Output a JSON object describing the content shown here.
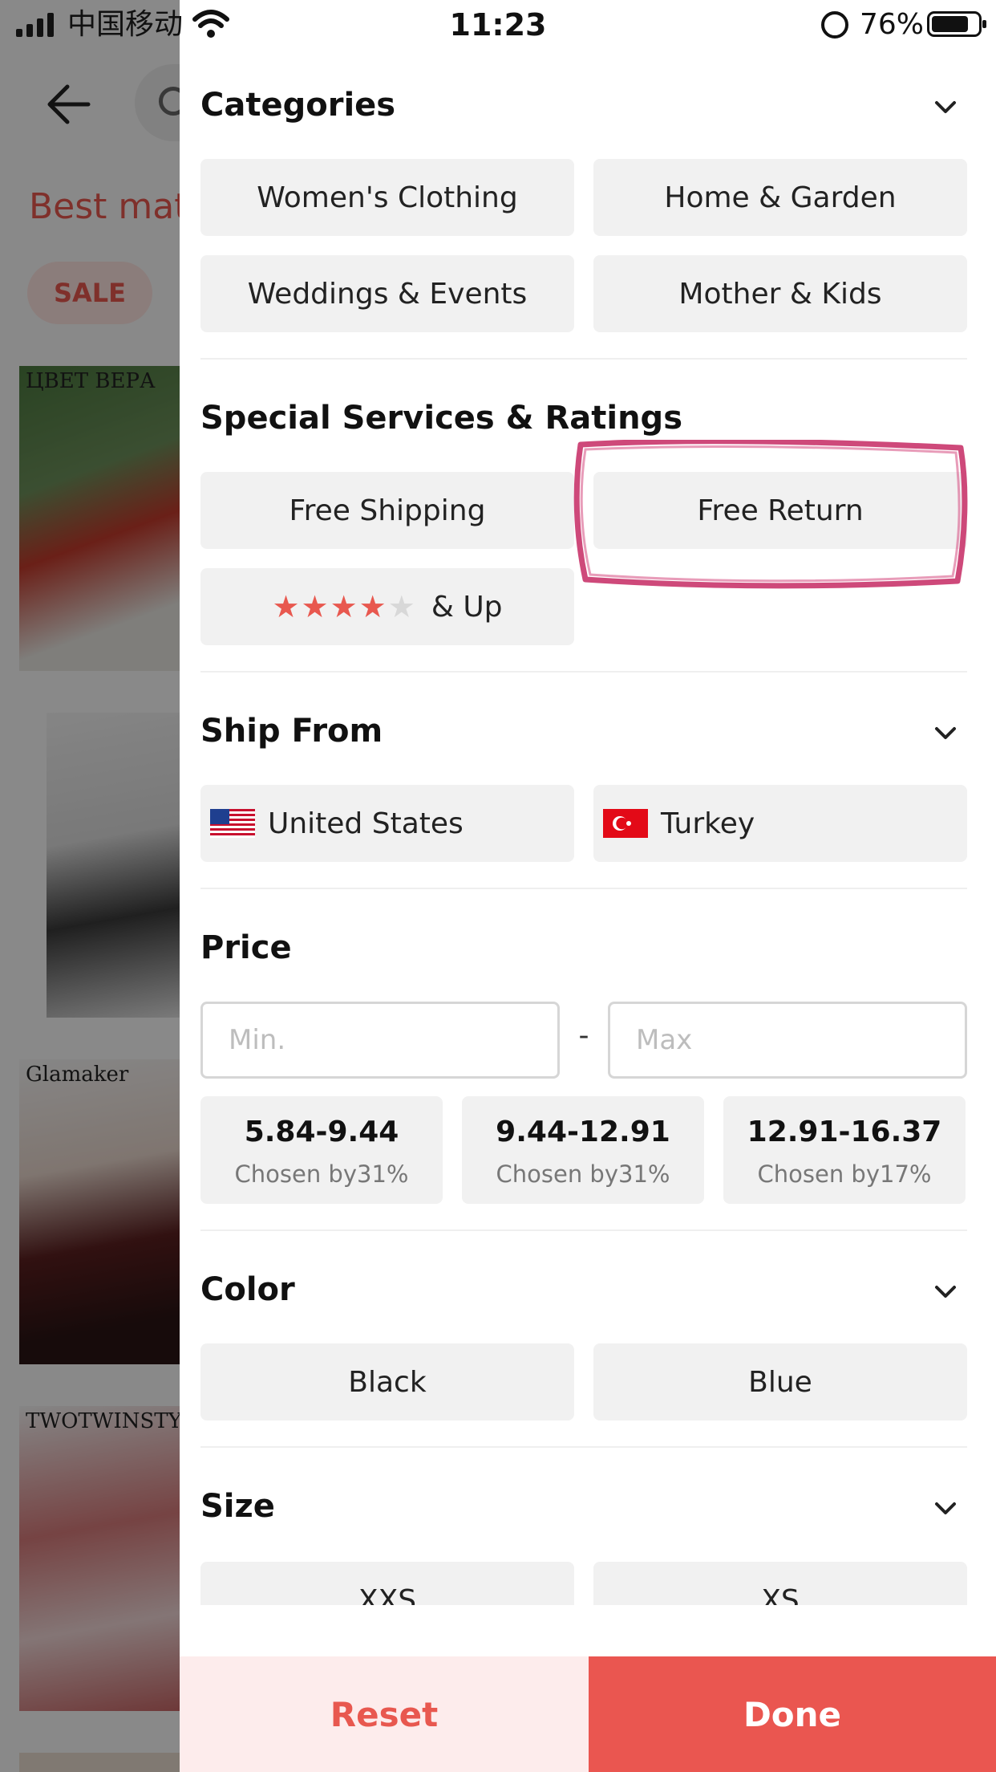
{
  "status_bar": {
    "carrier": "中国移动",
    "time": "11:23",
    "battery_percent": "76%"
  },
  "background": {
    "title": "Best matc",
    "sale_badge": "SALE",
    "card_brands": [
      "ЦВЕТ ВЕРА",
      "",
      "Glamaker",
      "TWOTWINSTYLE",
      ""
    ]
  },
  "filter": {
    "categories": {
      "title": "Categories",
      "items": [
        "Women's Clothing",
        "Home & Garden",
        "Weddings & Events",
        "Mother & Kids"
      ]
    },
    "services": {
      "title": "Special Services & Ratings",
      "items": [
        "Free Shipping",
        "Free Return"
      ],
      "rating_label": "& Up",
      "rating_stars": 4,
      "rating_max": 5
    },
    "ship_from": {
      "title": "Ship From",
      "items": [
        {
          "label": "United States",
          "flag": "us-flag-icon"
        },
        {
          "label": "Turkey",
          "flag": "turkey-flag-icon"
        }
      ]
    },
    "price": {
      "title": "Price",
      "min_placeholder": "Min.",
      "max_placeholder": "Max",
      "separator": "-",
      "ranges": [
        {
          "value": "5.84-9.44",
          "chosen": "Chosen by31%"
        },
        {
          "value": "9.44-12.91",
          "chosen": "Chosen by31%"
        },
        {
          "value": "12.91-16.37",
          "chosen": "Chosen by17%"
        }
      ]
    },
    "color": {
      "title": "Color",
      "items": [
        "Black",
        "Blue"
      ]
    },
    "size": {
      "title": "Size",
      "items": [
        "XXS",
        "XS"
      ]
    }
  },
  "actions": {
    "reset": "Reset",
    "done": "Done"
  },
  "colors": {
    "accent": "#ea5650",
    "accent_light": "#fdecec",
    "chip_bg": "#f1f1f1",
    "highlight_stroke": "#c9356b"
  }
}
